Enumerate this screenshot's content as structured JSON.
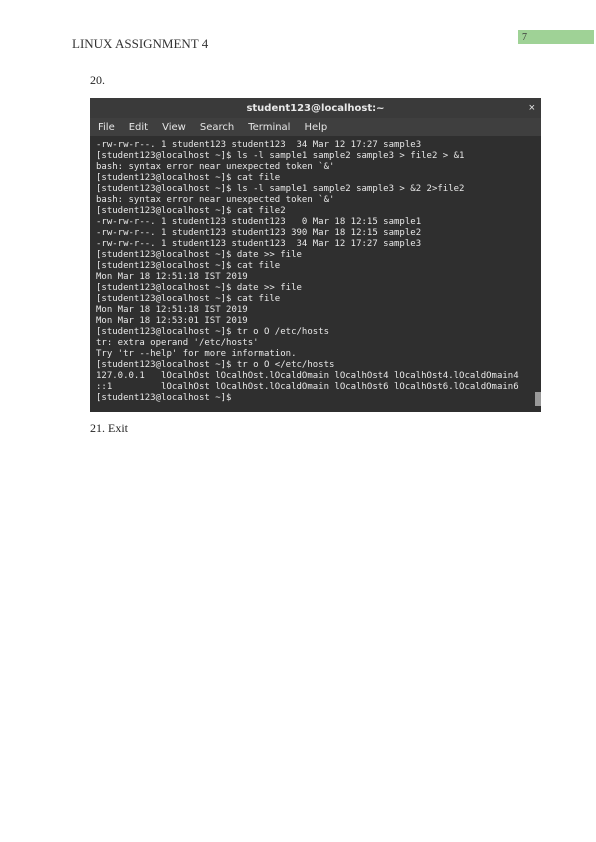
{
  "header": {
    "title": "LINUX ASSIGNMENT 4",
    "page_number": "7"
  },
  "items": {
    "q20_label": "20.",
    "q21_label": "21. Exit"
  },
  "terminal": {
    "window_title": "student123@localhost:~",
    "close_icon": "×",
    "menu": [
      "File",
      "Edit",
      "View",
      "Search",
      "Terminal",
      "Help"
    ],
    "lines": [
      "-rw-rw-r--. 1 student123 student123  34 Mar 12 17:27 sample3",
      "[student123@localhost ~]$ ls -l sample1 sample2 sample3 > file2 > &1",
      "bash: syntax error near unexpected token `&'",
      "[student123@localhost ~]$ cat file",
      "[student123@localhost ~]$ ls -l sample1 sample2 sample3 > &2 2>file2",
      "bash: syntax error near unexpected token `&'",
      "[student123@localhost ~]$ cat file2",
      "-rw-rw-r--. 1 student123 student123   0 Mar 18 12:15 sample1",
      "-rw-rw-r--. 1 student123 student123 390 Mar 18 12:15 sample2",
      "-rw-rw-r--. 1 student123 student123  34 Mar 12 17:27 sample3",
      "[student123@localhost ~]$ date >> file",
      "[student123@localhost ~]$ cat file",
      "Mon Mar 18 12:51:18 IST 2019",
      "[student123@localhost ~]$ date >> file",
      "[student123@localhost ~]$ cat file",
      "Mon Mar 18 12:51:18 IST 2019",
      "Mon Mar 18 12:53:01 IST 2019",
      "[student123@localhost ~]$ tr o O /etc/hosts",
      "tr: extra operand '/etc/hosts'",
      "Try 'tr --help' for more information.",
      "[student123@localhost ~]$ tr o O </etc/hosts",
      "127.0.0.1   lOcalhOst lOcalhOst.lOcaldOmain lOcalhOst4 lOcalhOst4.lOcaldOmain4",
      "::1         lOcalhOst lOcalhOst.lOcaldOmain lOcalhOst6 lOcalhOst6.lOcaldOmain6",
      "[student123@localhost ~]$"
    ]
  }
}
